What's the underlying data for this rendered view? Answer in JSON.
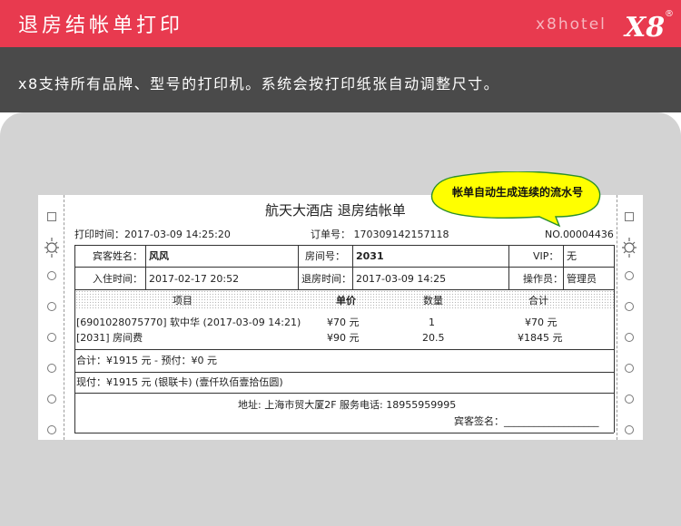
{
  "header": {
    "title": "退房结帐单打印",
    "brand": "x8hotel",
    "logo_text": "X8",
    "logo_mark": "®"
  },
  "subheader": {
    "text": "x8支持所有品牌、型号的打印机。系统会按打印纸张自动调整尺寸。"
  },
  "bubble": {
    "text": "帐单自动生成连续的流水号"
  },
  "receipt": {
    "title": "航天大酒店 退房结帐单",
    "print_time": "打印时间：2017-03-09 14:25:20",
    "order_label": "订单号：",
    "order_value": "170309142157118",
    "no": "NO.00004436",
    "guest_label": "宾客姓名：",
    "guest_value": "风风",
    "room_label": "房间号：",
    "room_value": "2031",
    "vip_label": "VIP：",
    "vip_value": "无",
    "checkin_label": "入住时间：",
    "checkin_value": "2017-02-17 20:52",
    "checkout_label": "退房时间：",
    "checkout_value": "2017-03-09 14:25",
    "operator_label": "操作员：",
    "operator_value": "管理员",
    "cols": [
      "项目",
      "单价",
      "数量",
      "合计"
    ],
    "items": [
      {
        "name": "[6901028075770] 软中华 (2017-03-09 14:21)",
        "price": "¥70 元",
        "qty": "1",
        "total": "¥70 元"
      },
      {
        "name": "[2031] 房间费",
        "price": "¥90 元",
        "qty": "20.5",
        "total": "¥1845 元"
      }
    ],
    "summary": "合计：¥1915 元 - 预付：¥0 元",
    "cash": "现付：¥1915 元 (银联卡) (壹仟玖佰壹拾伍圆)",
    "address": "地址: 上海市贸大厦2F 服务电话: 18955959995",
    "signature": "宾客签名：___________________"
  },
  "colors": {
    "header_red": "#e83a4f",
    "dark_band": "#4a4a4a",
    "bubble_yellow": "#ffff00",
    "panel_gray": "#d3d3d3"
  }
}
